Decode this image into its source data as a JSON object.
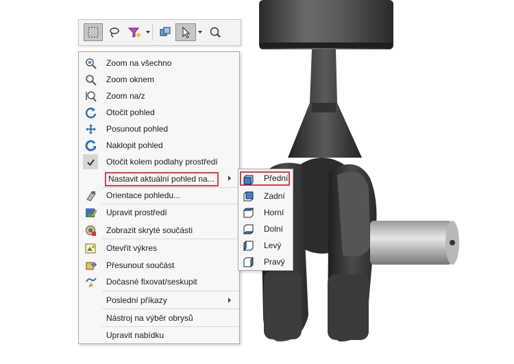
{
  "toolbar": {
    "buttons": [
      {
        "icon": "box-select-icon",
        "pressed": true
      },
      {
        "icon": "lasso-select-icon",
        "pressed": false
      },
      {
        "icon": "selection-filter-icon",
        "pressed": false,
        "dropdown": true
      },
      {
        "icon": "select-other-icon",
        "pressed": false
      },
      {
        "icon": "select-pointer-icon",
        "pressed": true,
        "dropdown": true
      },
      {
        "icon": "magnified-selection-icon",
        "pressed": false
      }
    ]
  },
  "menu": {
    "items": [
      {
        "label": "Zoom na všechno",
        "icon": "zoom-to-fit-icon"
      },
      {
        "label": "Zoom oknem",
        "icon": "zoom-to-area-icon"
      },
      {
        "label": "Zoom na/z",
        "icon": "zoom-in-out-icon"
      },
      {
        "label": "Otočit pohled",
        "icon": "rotate-view-icon"
      },
      {
        "label": "Posunout pohled",
        "icon": "pan-view-icon"
      },
      {
        "label": "Naklopit pohled",
        "icon": "roll-view-icon"
      },
      {
        "label": "Otočit kolem podlahy prostředí",
        "icon": "check-icon",
        "checked": true
      },
      {
        "label": "Nastavit aktuální pohled na...",
        "icon": "",
        "submenu": true,
        "highlighted": true
      },
      {
        "label": "Orientace pohledu...",
        "icon": "view-orientation-icon"
      },
      {
        "label": "Upravit prostředí",
        "icon": "edit-scene-icon"
      },
      {
        "label": "Zobrazit skryté součásti",
        "icon": "show-hidden-components-icon"
      },
      {
        "label": "Otevřít výkres",
        "icon": "open-drawing-icon"
      },
      {
        "label": "Přesunout součást",
        "icon": "move-component-icon"
      },
      {
        "label": "Dočasné fixovat/seskupit",
        "icon": "temporary-fix-icon"
      },
      {
        "label": "Poslední příkazy",
        "icon": "",
        "submenu": true
      },
      {
        "label": "Nástroj na výběr obrysů",
        "icon": ""
      },
      {
        "label": "Upravit nabídku",
        "icon": ""
      }
    ]
  },
  "submenu": {
    "items": [
      {
        "label": "Přední",
        "icon": "front-view-icon",
        "highlighted": true
      },
      {
        "label": "Zadní",
        "icon": "back-view-icon"
      },
      {
        "label": "Horní",
        "icon": "top-view-icon"
      },
      {
        "label": "Dolní",
        "icon": "bottom-view-icon"
      },
      {
        "label": "Levý",
        "icon": "left-view-icon"
      },
      {
        "label": "Pravý",
        "icon": "right-view-icon"
      }
    ]
  },
  "colors": {
    "highlight_frame": "#e03a3a",
    "menu_background": "#f7f7f7",
    "model_dark": "#3a3a3a",
    "model_light": "#cfcfcf"
  }
}
